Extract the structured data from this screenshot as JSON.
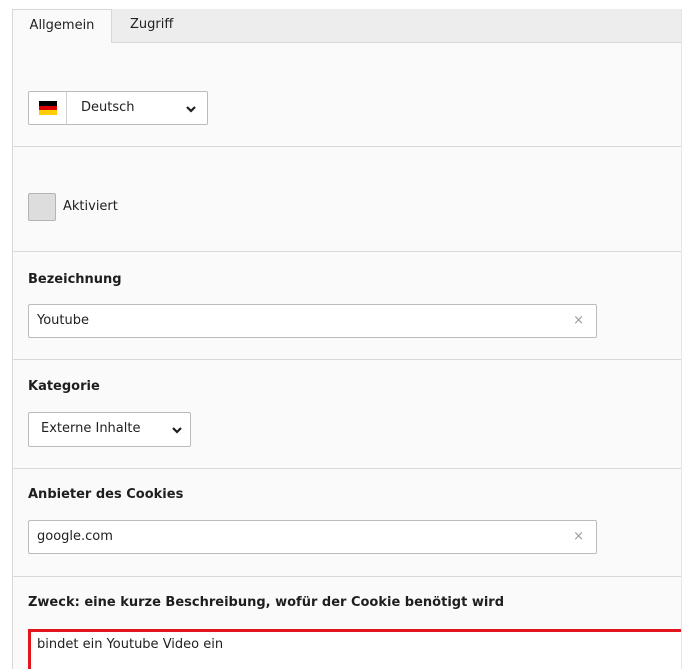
{
  "tabs": [
    {
      "label": "Allgemein",
      "active": true
    },
    {
      "label": "Zugriff",
      "active": false
    }
  ],
  "language": {
    "selected": "Deutsch",
    "flag_icon": "germany-flag-icon",
    "flag_colors": [
      "#000000",
      "#dd0000",
      "#ffce00"
    ]
  },
  "active_checkbox": {
    "label": "Aktiviert",
    "checked": false
  },
  "name_field": {
    "label": "Bezeichnung",
    "value": "Youtube",
    "clear_glyph": "×"
  },
  "category_field": {
    "label": "Kategorie",
    "selected": "Externe Inhalte"
  },
  "provider_field": {
    "label": "Anbieter des Cookies",
    "value": "google.com",
    "clear_glyph": "×"
  },
  "purpose_field": {
    "label": "Zweck: eine kurze Beschreibung, wofür der Cookie benötigt wird",
    "value": "bindet ein Youtube Video ein",
    "error_border_color": "#e3141e"
  }
}
